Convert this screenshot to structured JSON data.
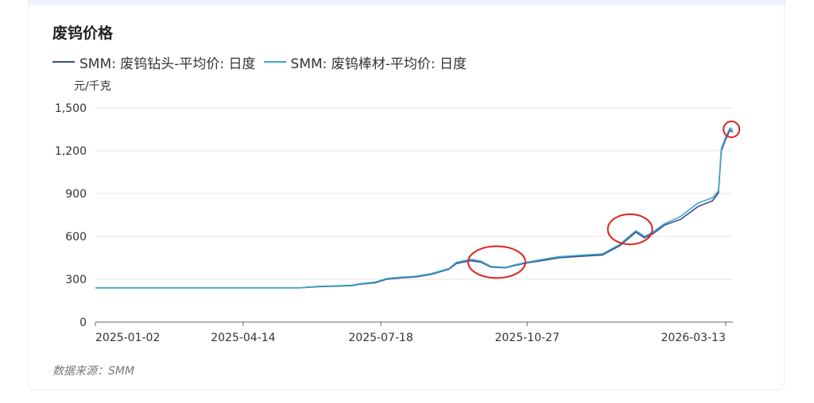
{
  "title": "废钨价格",
  "unit_label": "元/千克",
  "source": "数据来源：SMM",
  "chart_data": {
    "type": "line",
    "ylim": [
      0,
      1500
    ],
    "yticks": [
      0,
      300,
      600,
      900,
      1200,
      1500
    ],
    "ytick_labels": [
      "0",
      "300",
      "600",
      "900",
      "1,200",
      "1,500"
    ],
    "x_range": [
      "2025-01-02",
      "2026-03-18"
    ],
    "xticks": [
      "2025-01-02",
      "2025-04-14",
      "2025-07-18",
      "2025-10-27",
      "2026-03-13"
    ],
    "grid": true,
    "legend_position": "top-left",
    "annotations": [
      {
        "type": "circle",
        "x": "2025-10-06",
        "y": 420
      },
      {
        "type": "circle",
        "x": "2026-01-06",
        "y": 650
      },
      {
        "type": "circle",
        "x": "2026-03-17",
        "y": 1350
      }
    ],
    "series": [
      {
        "name": "SMM: 废钨钻头-平均价: 日度",
        "color": "#3d4b8c",
        "points": [
          [
            "2025-01-02",
            240
          ],
          [
            "2025-02-17",
            240
          ],
          [
            "2025-04-14",
            240
          ],
          [
            "2025-05-23",
            240
          ],
          [
            "2025-06-04",
            248
          ],
          [
            "2025-06-28",
            255
          ],
          [
            "2025-07-03",
            265
          ],
          [
            "2025-07-14",
            275
          ],
          [
            "2025-07-22",
            300
          ],
          [
            "2025-08-02",
            310
          ],
          [
            "2025-08-12",
            318
          ],
          [
            "2025-08-22",
            335
          ],
          [
            "2025-09-03",
            370
          ],
          [
            "2025-09-08",
            410
          ],
          [
            "2025-09-18",
            430
          ],
          [
            "2025-09-25",
            420
          ],
          [
            "2025-10-02",
            385
          ],
          [
            "2025-10-12",
            380
          ],
          [
            "2025-10-18",
            395
          ],
          [
            "2025-10-27",
            415
          ],
          [
            "2025-11-06",
            430
          ],
          [
            "2025-11-18",
            450
          ],
          [
            "2025-12-02",
            460
          ],
          [
            "2025-12-18",
            470
          ],
          [
            "2025-12-30",
            535
          ],
          [
            "2026-01-10",
            630
          ],
          [
            "2026-01-16",
            590
          ],
          [
            "2026-01-22",
            620
          ],
          [
            "2026-01-30",
            680
          ],
          [
            "2026-02-10",
            720
          ],
          [
            "2026-02-22",
            810
          ],
          [
            "2026-03-04",
            850
          ],
          [
            "2026-03-08",
            905
          ],
          [
            "2026-03-10",
            1200
          ],
          [
            "2026-03-13",
            1280
          ],
          [
            "2026-03-16",
            1345
          ],
          [
            "2026-03-18",
            1330
          ]
        ]
      },
      {
        "name": "SMM: 废钨棒材-平均价: 日度",
        "color": "#3aa8c8",
        "points": [
          [
            "2025-01-02",
            240
          ],
          [
            "2025-02-17",
            240
          ],
          [
            "2025-04-14",
            240
          ],
          [
            "2025-05-23",
            240
          ],
          [
            "2025-06-04",
            250
          ],
          [
            "2025-06-28",
            258
          ],
          [
            "2025-07-03",
            268
          ],
          [
            "2025-07-14",
            280
          ],
          [
            "2025-07-22",
            305
          ],
          [
            "2025-08-02",
            315
          ],
          [
            "2025-08-12",
            322
          ],
          [
            "2025-08-22",
            340
          ],
          [
            "2025-09-03",
            375
          ],
          [
            "2025-09-08",
            418
          ],
          [
            "2025-09-18",
            440
          ],
          [
            "2025-09-25",
            428
          ],
          [
            "2025-10-02",
            390
          ],
          [
            "2025-10-12",
            383
          ],
          [
            "2025-10-18",
            400
          ],
          [
            "2025-10-27",
            420
          ],
          [
            "2025-11-06",
            438
          ],
          [
            "2025-11-18",
            458
          ],
          [
            "2025-12-02",
            468
          ],
          [
            "2025-12-18",
            478
          ],
          [
            "2025-12-30",
            545
          ],
          [
            "2026-01-10",
            640
          ],
          [
            "2026-01-16",
            600
          ],
          [
            "2026-01-22",
            632
          ],
          [
            "2026-01-30",
            690
          ],
          [
            "2026-02-10",
            740
          ],
          [
            "2026-02-22",
            835
          ],
          [
            "2026-03-04",
            870
          ],
          [
            "2026-03-08",
            920
          ],
          [
            "2026-03-10",
            1215
          ],
          [
            "2026-03-13",
            1295
          ],
          [
            "2026-03-16",
            1360
          ],
          [
            "2026-03-18",
            1345
          ]
        ]
      }
    ]
  }
}
